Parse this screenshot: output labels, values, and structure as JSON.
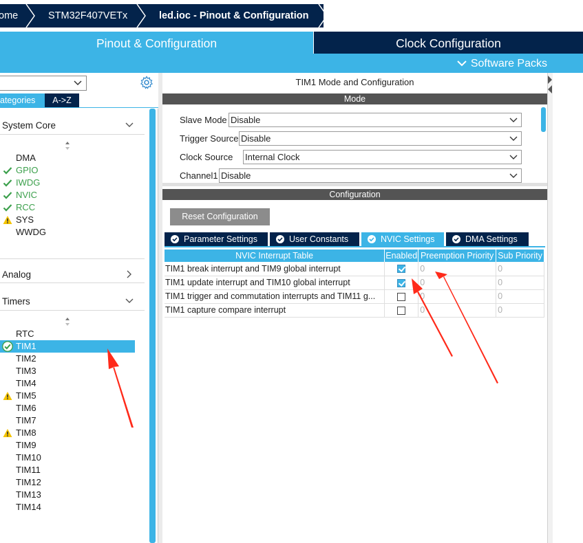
{
  "breadcrumb": {
    "items": [
      "ome",
      "STM32F407VETx",
      "led.ioc - Pinout & Configuration"
    ]
  },
  "main_tabs": {
    "pinout": "Pinout & Configuration",
    "clock": "Clock Configuration",
    "software_packs": "Software Packs"
  },
  "left": {
    "tab_categories": "ategories",
    "tab_az": "A->Z",
    "sections": {
      "system_core": "System Core",
      "analog": "Analog",
      "timers": "Timers"
    },
    "system_core_items": [
      {
        "name": "DMA",
        "status": "none"
      },
      {
        "name": "GPIO",
        "status": "ok"
      },
      {
        "name": "IWDG",
        "status": "ok"
      },
      {
        "name": "NVIC",
        "status": "ok"
      },
      {
        "name": "RCC",
        "status": "ok"
      },
      {
        "name": "SYS",
        "status": "warning"
      },
      {
        "name": "WWDG",
        "status": "none"
      }
    ],
    "timer_items": [
      {
        "name": "RTC",
        "status": "none"
      },
      {
        "name": "TIM1",
        "status": "ok-selected"
      },
      {
        "name": "TIM2",
        "status": "none"
      },
      {
        "name": "TIM3",
        "status": "none"
      },
      {
        "name": "TIM4",
        "status": "none"
      },
      {
        "name": "TIM5",
        "status": "warning"
      },
      {
        "name": "TIM6",
        "status": "none"
      },
      {
        "name": "TIM7",
        "status": "none"
      },
      {
        "name": "TIM8",
        "status": "warning"
      },
      {
        "name": "TIM9",
        "status": "none"
      },
      {
        "name": "TIM10",
        "status": "none"
      },
      {
        "name": "TIM11",
        "status": "none"
      },
      {
        "name": "TIM12",
        "status": "none"
      },
      {
        "name": "TIM13",
        "status": "none"
      },
      {
        "name": "TIM14",
        "status": "none"
      }
    ]
  },
  "right": {
    "title": "TIM1 Mode and Configuration",
    "mode_header": "Mode",
    "mode_rows": [
      {
        "label": "Slave Mode",
        "value": "Disable"
      },
      {
        "label": "Trigger Source",
        "value": "Disable"
      },
      {
        "label": "Clock Source",
        "value": "Internal Clock"
      },
      {
        "label": "Channel1",
        "value": "Disable"
      }
    ],
    "config_header": "Configuration",
    "reset_button": "Reset Configuration",
    "config_tabs": [
      "Parameter Settings",
      "User Constants",
      "NVIC Settings",
      "DMA Settings"
    ],
    "active_tab": "NVIC Settings",
    "nvic_table": {
      "columns": [
        "NVIC Interrupt Table",
        "Enabled",
        "Preemption Priority",
        "Sub Priority"
      ],
      "rows": [
        {
          "name": "TIM1 break interrupt and TIM9 global interrupt",
          "enabled": true,
          "preemption": "0",
          "sub": "0"
        },
        {
          "name": "TIM1 update interrupt and TIM10 global interrupt",
          "enabled": true,
          "preemption": "0",
          "sub": "0"
        },
        {
          "name": "TIM1 trigger and commutation interrupts and TIM11 g...",
          "enabled": false,
          "preemption": "0",
          "sub": "0"
        },
        {
          "name": "TIM1 capture compare interrupt",
          "enabled": false,
          "preemption": "0",
          "sub": "0"
        }
      ]
    }
  },
  "colors": {
    "navy": "#03234b",
    "accent": "#3cb4e6",
    "ok_green": "#3ca04c",
    "warning_yellow": "#f5c400",
    "annotation_red": "#ff2a1a"
  },
  "icons": [
    "gear-icon",
    "chevron-down-icon",
    "chevron-right-icon",
    "check-icon",
    "warning-icon",
    "sort-icon",
    "check-circle-icon"
  ]
}
